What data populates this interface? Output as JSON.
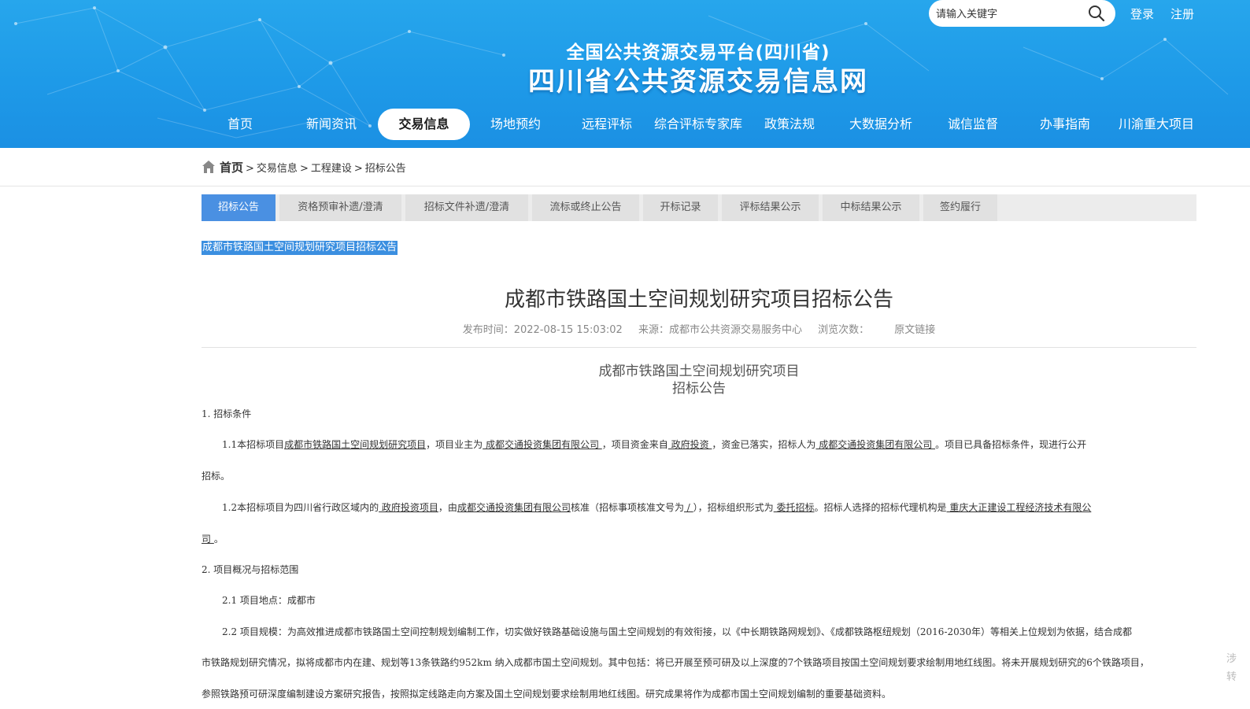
{
  "search": {
    "placeholder": "请输入关键字",
    "icon": "search-icon"
  },
  "top_links": {
    "login": "登录",
    "register": "注册"
  },
  "site": {
    "subtitle": "全国公共资源交易平台(四川省)",
    "title": "四川省公共资源交易信息网"
  },
  "nav": [
    "首页",
    "新闻资讯",
    "交易信息",
    "场地预约",
    "远程评标",
    "综合评标专家库",
    "政策法规",
    "大数据分析",
    "诚信监督",
    "办事指南",
    "川渝重大项目"
  ],
  "nav_active_index": 2,
  "breadcrumb": {
    "home": "首页",
    "items": [
      "交易信息",
      "工程建设",
      "招标公告"
    ],
    "sep": ">"
  },
  "tabs": [
    "招标公告",
    "资格预审补遗/澄清",
    "招标文件补遗/澄清",
    "流标或终止公告",
    "开标记录",
    "评标结果公示",
    "中标结果公示",
    "签约履行"
  ],
  "tabs_active_index": 0,
  "selected_title": "成都市铁路国土空间规划研究项目招标公告",
  "article": {
    "title": "成都市铁路国土空间规划研究项目招标公告",
    "publish_time": "发布时间：2022-08-15 15:03:02",
    "source": "来源：成都市公共资源交易服务中心",
    "views": "浏览次数：",
    "original_link": "原文链接",
    "doc_title_1": "成都市铁路国土空间规划研究项目",
    "doc_title_2": "招标公告",
    "s1": "1. 招标条件",
    "p11_a": "1.1本招标项目",
    "p11_b": "成都市铁路国土空间规划研究项目",
    "p11_c": "，项目业主为",
    "p11_d": "  成都交通投资集团有限公司  ",
    "p11_e": "，项目资金来自",
    "p11_f": "  政府投资  ",
    "p11_g": "，资金已落实，招标人为",
    "p11_h": "  成都交通投资集团有限公司  ",
    "p11_i": "。项目已具备招标条件，现进行公开",
    "p11_j": "招标。",
    "p12_a": "1.2本招标项目为四川省行政区域内的",
    "p12_b": "  政府投资项目",
    "p12_c": "，由",
    "p12_d": "成都交通投资集团有限公司",
    "p12_e": "核准（招标事项核准文号为",
    "p12_f": "  /  ",
    "p12_g": "），招标组织形式为",
    "p12_h": "  委托招标",
    "p12_i": "。招标人选择的招标代理机构是",
    "p12_j": "  重庆大正建设工程经济技术有限公",
    "p12_k": "司  ",
    "p12_l": "。",
    "s2": "2. 项目概况与招标范围",
    "p21": "2.1 项目地点：成都市",
    "p22_1": "2.2 项目规模：为高效推进成都市铁路国土空间控制规划编制工作，切实做好铁路基础设施与国土空间规划的有效衔接，以《中长期铁路网规划》、《成都铁路枢纽规划（2016-2030年）等相关上位规划为依据，结合成都",
    "p22_2": "市铁路规划研究情况，拟将成都市内在建、规划等13条铁路约952km 纳入成都市国土空间规划。其中包括：将已开展至预可研及以上深度的7个铁路项目按国土空间规划要求绘制用地红线图。将未开展规划研究的6个铁路项目，",
    "p22_3": "参照铁路预可研深度编制建设方案研究报告，按照拟定线路走向方案及国土空间规划要求绘制用地红线图。研究成果将作为成都市国土空间规划编制的重要基础资料。"
  },
  "edge_chars": [
    "涉",
    "转"
  ]
}
